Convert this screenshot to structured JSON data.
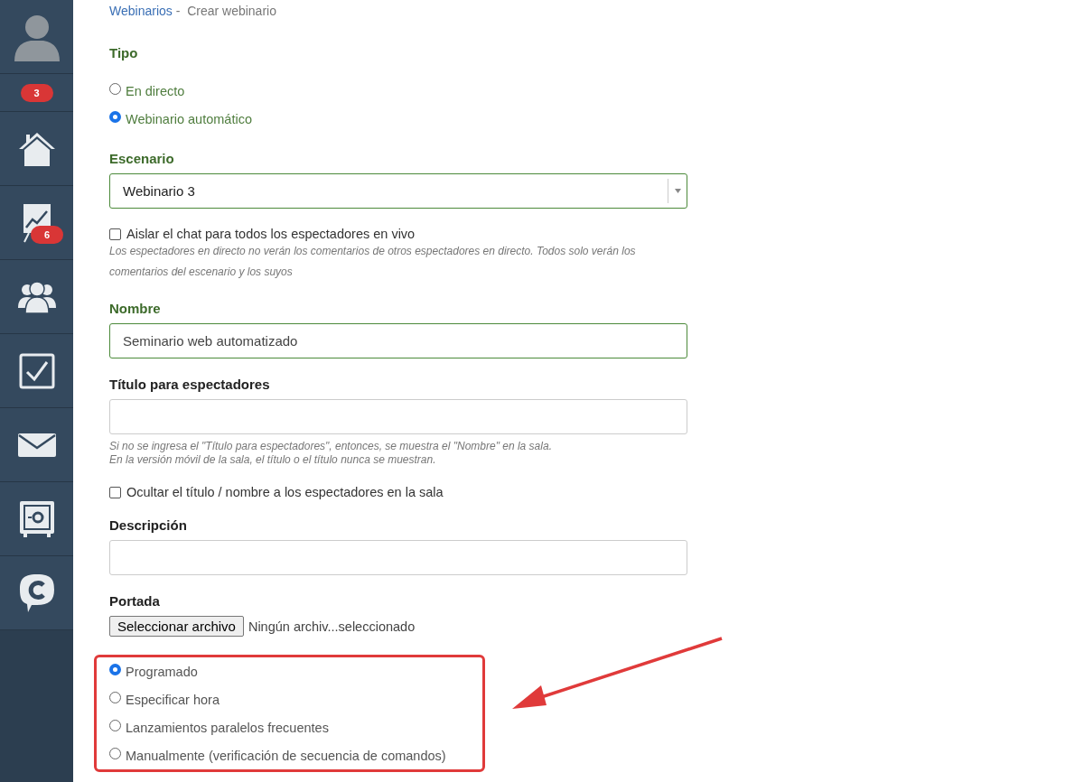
{
  "sidebar": {
    "items": [
      {
        "kind": "avatar"
      },
      {
        "kind": "badge",
        "badge": "3"
      },
      {
        "kind": "home"
      },
      {
        "kind": "chart",
        "badge": "6"
      },
      {
        "kind": "users"
      },
      {
        "kind": "tasks"
      },
      {
        "kind": "mail"
      },
      {
        "kind": "safe"
      },
      {
        "kind": "chat"
      }
    ]
  },
  "breadcrumb": {
    "link": "Webinarios",
    "separator": "-",
    "current": "Crear webinario"
  },
  "form": [
    {
      "kind": "radios",
      "label": "Tipo",
      "valid": true,
      "options": [
        {
          "label": "En directo",
          "selected": false
        },
        {
          "label": "Webinario automático",
          "selected": true
        }
      ]
    },
    {
      "kind": "select",
      "label": "Escenario",
      "valid": true,
      "value": "Webinario 3"
    },
    {
      "kind": "checkbox",
      "label": "Aislar el chat para todos los espectadores en vivo",
      "checked": false,
      "hint": "Los espectadores en directo no verán los comentarios de otros espectadores en directo. Todos solo verán los comentarios del escenario y los suyos"
    },
    {
      "kind": "text",
      "label": "Nombre",
      "valid": true,
      "value": "Seminario web automatizado"
    },
    {
      "kind": "text",
      "label": "Título para espectadores",
      "valid": false,
      "hint": "Si no se ingresa el \"Título para espectadores\", entonces, se muestra el \"Nombre\" en la sala.\nEn la versión móvil de la sala, el título o el título nunca se muestran."
    },
    {
      "kind": "checkbox",
      "label": "Ocultar el título / nombre a los espectadores en la sala",
      "checked": false
    },
    {
      "kind": "text",
      "label": "Descripción",
      "valid": false
    },
    {
      "kind": "file",
      "label": "Portada",
      "button": "Seleccionar archivo",
      "status": "Ningún archiv...seleccionado"
    },
    {
      "kind": "radios",
      "highlighted": true,
      "options": [
        {
          "label": "Programado",
          "selected": true
        },
        {
          "label": "Especificar hora",
          "selected": false
        },
        {
          "label": "Lanzamientos paralelos frecuentes",
          "selected": false
        },
        {
          "label": "Manualmente (verificación de secuencia de comandos)",
          "selected": false
        }
      ]
    }
  ]
}
